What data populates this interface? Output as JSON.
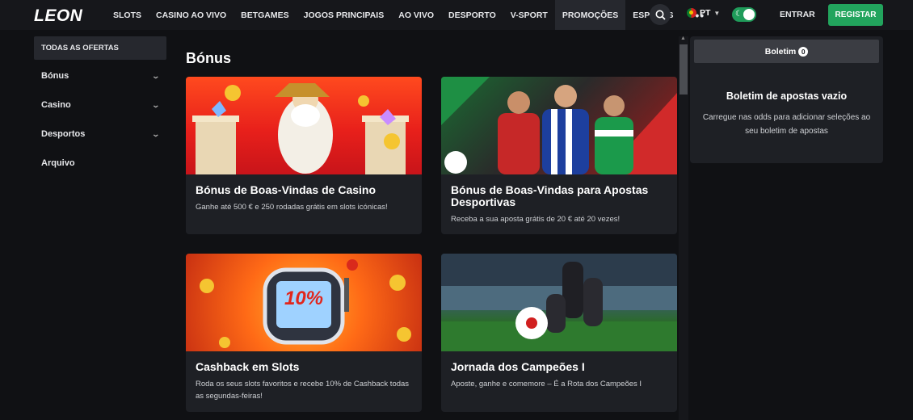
{
  "brand": {
    "logo": "LEON"
  },
  "nav": {
    "items": [
      "SLOTS",
      "CASINO AO VIVO",
      "BETGAMES",
      "JOGOS PRINCIPAIS",
      "AO VIVO",
      "DESPORTO",
      "V-SPORT",
      "PROMOÇÕES",
      "ESPORTS"
    ],
    "active": "PROMOÇÕES",
    "more": "•••"
  },
  "header": {
    "language": "PT",
    "login_label": "ENTRAR",
    "register_label": "REGISTAR"
  },
  "sidebar": {
    "items": [
      {
        "label": "TODAS AS OFERTAS",
        "active": true,
        "expandable": false
      },
      {
        "label": "Bónus",
        "active": false,
        "expandable": true
      },
      {
        "label": "Casino",
        "active": false,
        "expandable": true
      },
      {
        "label": "Desportos",
        "active": false,
        "expandable": true
      },
      {
        "label": "Arquivo",
        "active": false,
        "expandable": false
      }
    ]
  },
  "main": {
    "title": "Bónus",
    "cards": [
      {
        "title": "Bónus de Boas-Vindas de Casino",
        "description": "Ganhe até 500 € e 250 rodadas grátis em slots icónicas!",
        "image": "casino-zeus-banner"
      },
      {
        "title": "Bónus de Boas-Vindas para Apostas Desportivas",
        "description": "Receba a sua aposta grátis de 20 € até 20 vezes!",
        "image": "football-players-banner"
      },
      {
        "title": "Cashback em Slots",
        "description": "Roda os seus slots favoritos e recebe 10% de Cashback todas as segundas-feiras!",
        "image": "slot-machine-10-percent-banner",
        "badge": "10%"
      },
      {
        "title": "Jornada dos Campeões I",
        "description": "Aposte, ganhe e comemore – É a Rota dos Campeões I",
        "image": "stadium-football-banner"
      }
    ]
  },
  "betslip": {
    "tab_label": "Boletim",
    "count": "0",
    "empty_title": "Boletim de apostas vazio",
    "empty_desc": "Carregue nas odds para adicionar seleções ao seu boletim de apostas"
  },
  "colors": {
    "accent": "#22a45d",
    "background": "#101114",
    "card": "#1e2025"
  }
}
